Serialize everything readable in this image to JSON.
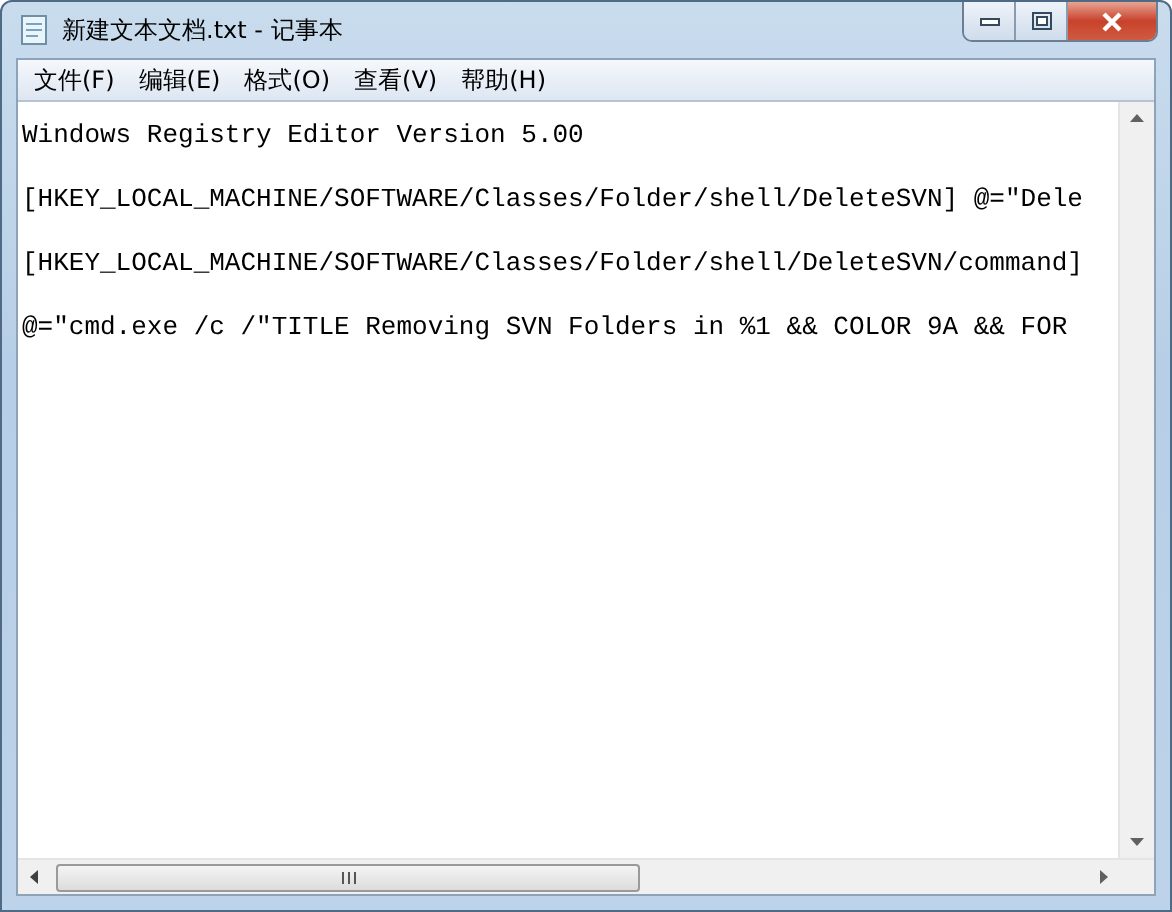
{
  "window": {
    "title": "新建文本文档.txt - 记事本"
  },
  "menu": [
    "文件(F)",
    "编辑(E)",
    "格式(O)",
    "查看(V)",
    "帮助(H)"
  ],
  "lines": [
    "Windows Registry Editor Version 5.00",
    "[HKEY_LOCAL_MACHINE/SOFTWARE/Classes/Folder/shell/DeleteSVN] @=\"Dele",
    "[HKEY_LOCAL_MACHINE/SOFTWARE/Classes/Folder/shell/DeleteSVN/command]",
    "@=\"cmd.exe /c /\"TITLE Removing SVN Folders in %1 && COLOR 9A && FOR"
  ]
}
